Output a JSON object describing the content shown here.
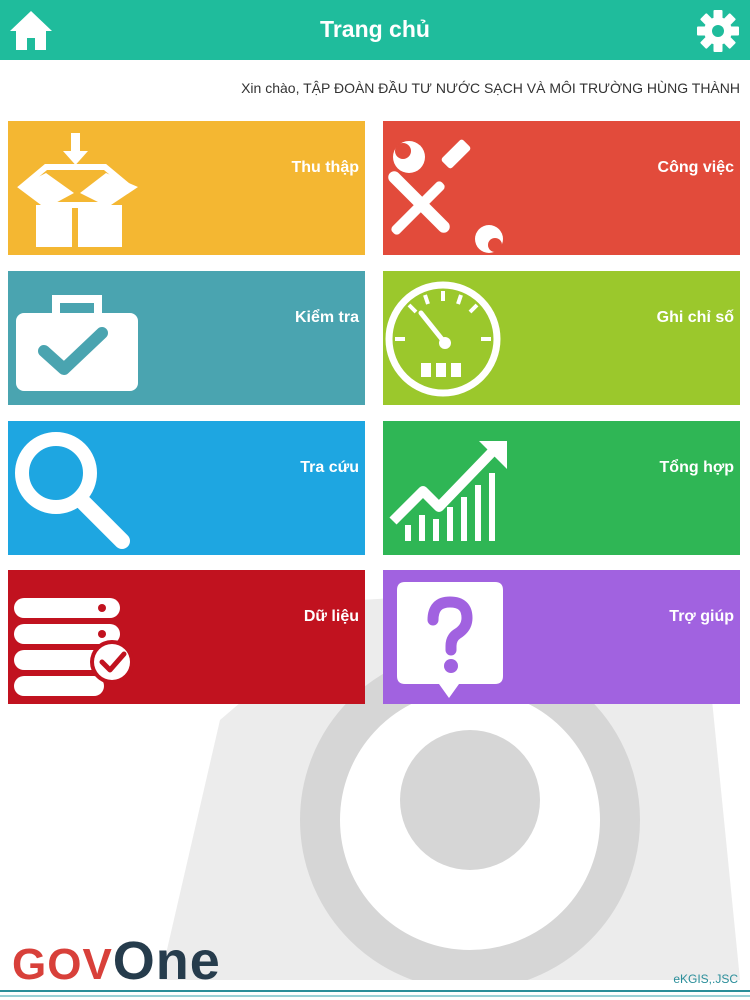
{
  "header": {
    "title": "Trang chủ",
    "home_icon": "home-icon",
    "settings_icon": "gear-icon",
    "color": "#1fbc9c"
  },
  "greeting": "Xin chào, TẬP ĐOÀN ĐẦU TƯ NƯỚC SẠCH VÀ MÔI TRƯỜNG HÙNG THÀNH",
  "tiles": [
    {
      "label": "Thu thập",
      "icon": "package-download-icon",
      "color": "#f4b732"
    },
    {
      "label": "Công việc",
      "icon": "tools-icon",
      "color": "#e24b3b"
    },
    {
      "label": "Kiểm tra",
      "icon": "briefcase-check-icon",
      "color": "#4aa4b0"
    },
    {
      "label": "Ghi chỉ số",
      "icon": "gauge-icon",
      "color": "#9bc82c"
    },
    {
      "label": "Tra cứu",
      "icon": "search-icon",
      "color": "#1ea6e1"
    },
    {
      "label": "Tổng hợp",
      "icon": "chart-growth-icon",
      "color": "#2fb655"
    },
    {
      "label": "Dữ liệu",
      "icon": "database-check-icon",
      "color": "#c1121f"
    },
    {
      "label": "Trợ giúp",
      "icon": "help-bubble-icon",
      "color": "#a162e0"
    }
  ],
  "footer": {
    "logo_part1": "GOV",
    "logo_part2": "One",
    "brand": "eKGIS,.JSC"
  }
}
